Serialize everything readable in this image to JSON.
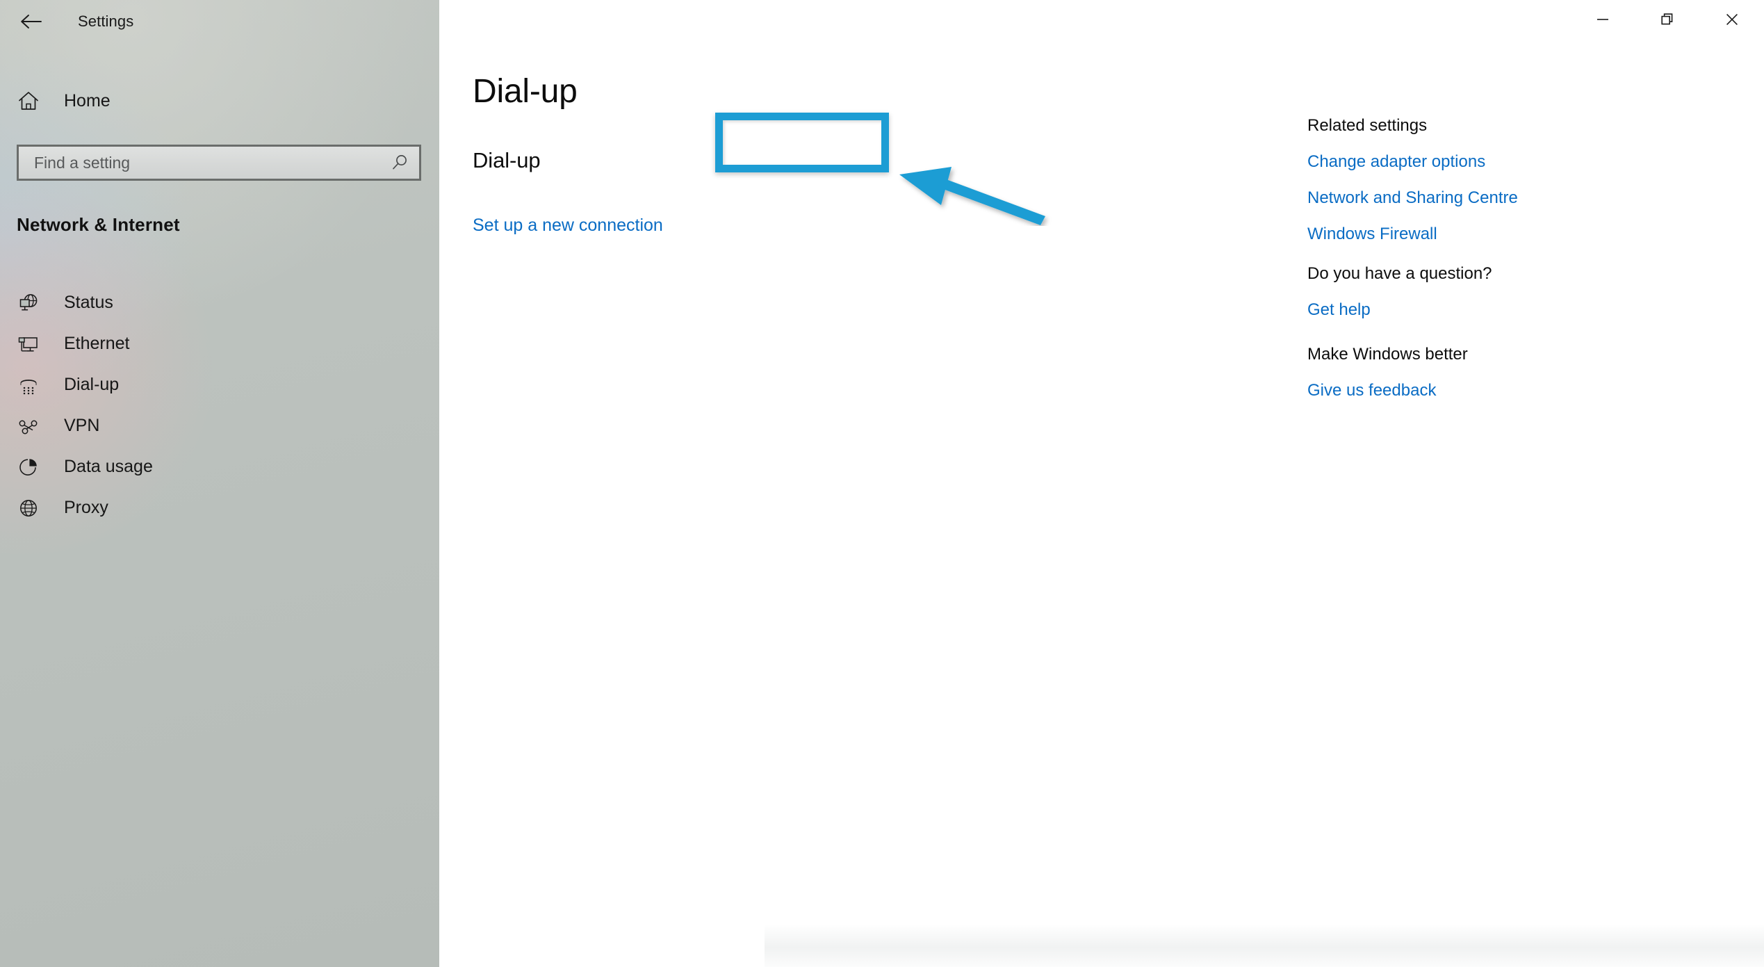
{
  "window": {
    "app_title": "Settings",
    "back_icon": "back-arrow-icon",
    "controls": {
      "minimize_label": "Minimize",
      "restore_label": "Restore",
      "close_label": "Close"
    }
  },
  "sidebar": {
    "home_label": "Home",
    "home_icon": "home-icon",
    "search": {
      "placeholder": "Find a setting",
      "value": "",
      "icon": "search-icon"
    },
    "category_title": "Network & Internet",
    "items": [
      {
        "label": "Status",
        "icon": "globe-monitor-icon",
        "selected": false
      },
      {
        "label": "Ethernet",
        "icon": "ethernet-icon",
        "selected": false
      },
      {
        "label": "Dial-up",
        "icon": "dialup-phone-icon",
        "selected": true
      },
      {
        "label": "VPN",
        "icon": "vpn-icon",
        "selected": false
      },
      {
        "label": "Data usage",
        "icon": "pie-chart-icon",
        "selected": false
      },
      {
        "label": "Proxy",
        "icon": "globe-icon",
        "selected": false
      }
    ]
  },
  "main": {
    "page_title": "Dial-up",
    "sub_heading": "Dial-up",
    "setup_link": "Set up a new connection"
  },
  "annotations": {
    "highlight_color": "#1d9dd4",
    "arrow_color": "#1d9dd4",
    "highlight_target": "Set up a new connection"
  },
  "right_panel": {
    "groups": [
      {
        "heading": "Related settings",
        "links": [
          "Change adapter options",
          "Network and Sharing Centre",
          "Windows Firewall"
        ]
      },
      {
        "heading": "Do you have a question?",
        "links": [
          "Get help"
        ]
      },
      {
        "heading": "Make Windows better",
        "links": [
          "Give us feedback"
        ]
      }
    ]
  },
  "colors": {
    "accent_link": "#0a6cc4",
    "sidebar_bg": "#b9c0bc",
    "content_bg": "#ffffff",
    "annotation": "#1d9dd4"
  }
}
